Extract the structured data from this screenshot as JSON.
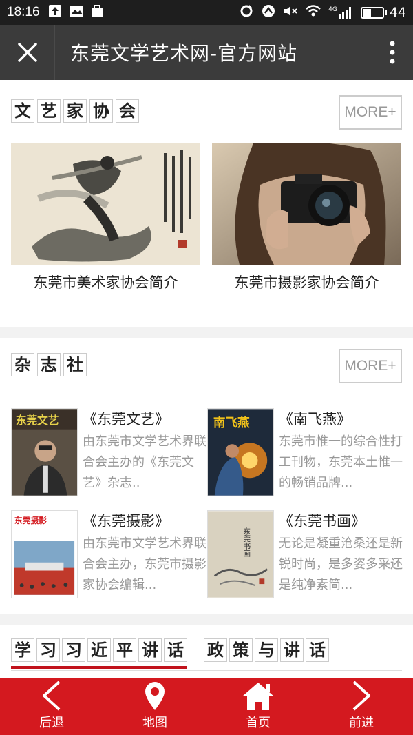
{
  "status_bar": {
    "time": "18:16",
    "network": "4G",
    "battery": "44",
    "battery_level": 0.44
  },
  "title_bar": {
    "title": "东莞文学艺术网-官方网站"
  },
  "section_associations": {
    "title_chars": [
      "文",
      "艺",
      "家",
      "协",
      "会"
    ],
    "more_label": "MORE+",
    "items": [
      {
        "caption": "东莞市美术家协会简介",
        "image": "ink-painting-dancer"
      },
      {
        "caption": "东莞市摄影家协会简介",
        "image": "person-with-camera"
      }
    ]
  },
  "section_magazines": {
    "title_chars": [
      "杂",
      "志",
      "社"
    ],
    "more_label": "MORE+",
    "items": [
      {
        "title": "《东莞文艺》",
        "desc": "由东莞市文学艺术界联合会主办的《东莞文艺》杂志..",
        "cover_text": "东莞文艺"
      },
      {
        "title": "《南飞燕》",
        "desc": "东莞市惟一的综合性打工刊物，东莞本土惟一的畅销品牌...",
        "cover_text": "南飞燕"
      },
      {
        "title": "《东莞摄影》",
        "desc": "由东莞市文学艺术界联合会主办，东莞市摄影家协会编辑...",
        "cover_text": "东莞摄影"
      },
      {
        "title": "《东莞书画》",
        "desc": "无论是凝重沧桑还是新锐时尚，是多姿多采还是纯净素简...",
        "cover_text": "东莞书画"
      }
    ]
  },
  "section_tabs": {
    "tabs": [
      {
        "chars": [
          "学",
          "习",
          "习",
          "近",
          "平",
          "讲",
          "话"
        ],
        "active": true
      },
      {
        "chars": [
          "政",
          "策",
          "与",
          "讲",
          "话"
        ],
        "active": false
      }
    ]
  },
  "bottom_nav": {
    "items": [
      {
        "label": "后退",
        "icon": "chevron-left-icon"
      },
      {
        "label": "地图",
        "icon": "map-pin-icon"
      },
      {
        "label": "首页",
        "icon": "home-icon"
      },
      {
        "label": "前进",
        "icon": "chevron-right-icon"
      }
    ]
  },
  "colors": {
    "accent": "#d4191f",
    "titlebar": "#3b3b3b",
    "statusbar": "#1e1e1e"
  }
}
